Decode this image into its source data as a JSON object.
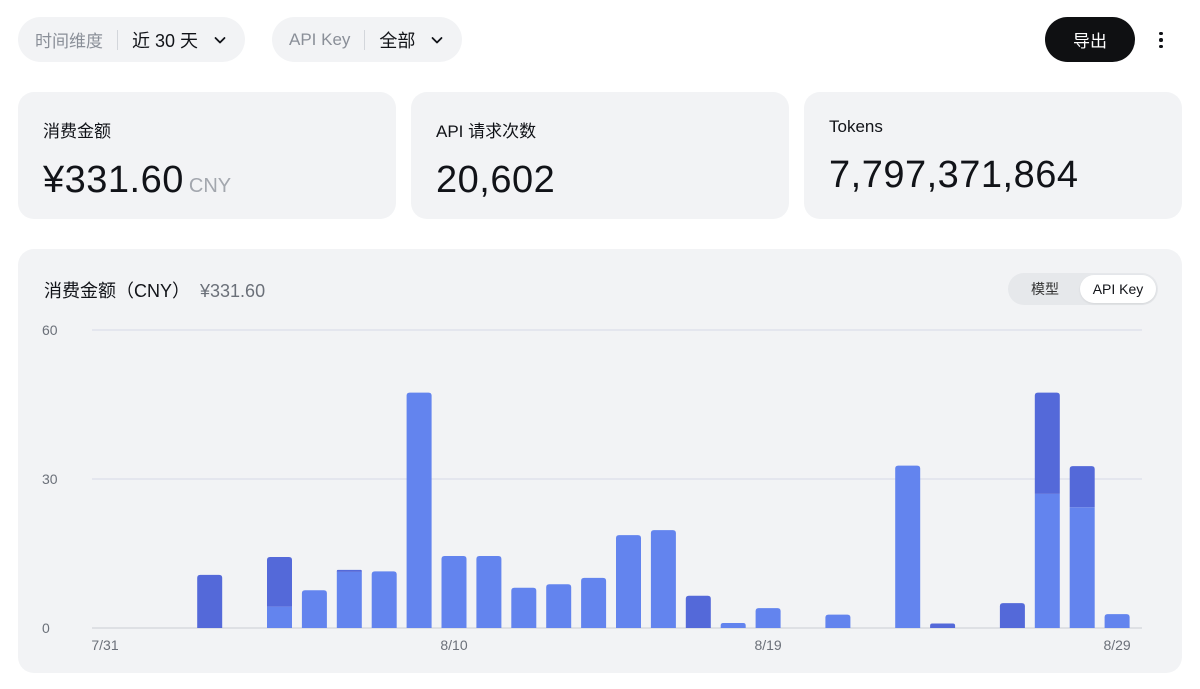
{
  "filters": {
    "time": {
      "label": "时间维度",
      "value": "近 30 天"
    },
    "apikey": {
      "label": "API Key",
      "value": "全部"
    }
  },
  "toolbar": {
    "export_label": "导出"
  },
  "stats": [
    {
      "title": "消费金额",
      "value": "¥331.60",
      "unit": "CNY"
    },
    {
      "title": "API 请求次数",
      "value": "20,602"
    },
    {
      "title": "Tokens",
      "value": "7,797,371,864"
    }
  ],
  "chart_panel": {
    "title": "消费金额（CNY）",
    "total": "¥331.60",
    "toggle": {
      "options": [
        "模型",
        "API Key"
      ],
      "selected": "API Key"
    }
  },
  "colors": {
    "series_a": "#6384ee",
    "series_b": "#5469d9",
    "grid": "#d6dae6",
    "axis": "#c9cdd4"
  },
  "chart_data": {
    "type": "bar",
    "stacked": true,
    "x": [
      "7/31",
      "8/1",
      "8/2",
      "8/3",
      "8/4",
      "8/5",
      "8/6",
      "8/7",
      "8/8",
      "8/9",
      "8/10",
      "8/11",
      "8/12",
      "8/13",
      "8/14",
      "8/15",
      "8/16",
      "8/17",
      "8/18",
      "8/19",
      "8/20",
      "8/21",
      "8/22",
      "8/23",
      "8/24",
      "8/25",
      "8/26",
      "8/27",
      "8/28",
      "8/29"
    ],
    "x_tick_labels": [
      "7/31",
      "8/10",
      "8/19",
      "8/29"
    ],
    "y_ticks": [
      0,
      30,
      60
    ],
    "ylim": [
      0,
      60
    ],
    "series": [
      {
        "values": [
          0,
          0,
          0,
          0,
          0,
          4.3,
          7.6,
          11.3,
          11.4,
          47.4,
          14.5,
          14.5,
          8.1,
          8.8,
          10.1,
          18.7,
          19.7,
          0,
          1.0,
          4.0,
          0,
          2.7,
          0,
          32.7,
          0,
          0,
          0,
          27.0,
          24.3,
          2.8
        ]
      },
      {
        "values": [
          0,
          0,
          0,
          10.7,
          0,
          10.0,
          0,
          0.4,
          0,
          0,
          0,
          0,
          0,
          0,
          0,
          0,
          0,
          6.5,
          0,
          0,
          0,
          0,
          0,
          0,
          0.9,
          0,
          5.0,
          20.4,
          8.3,
          0
        ]
      }
    ]
  }
}
